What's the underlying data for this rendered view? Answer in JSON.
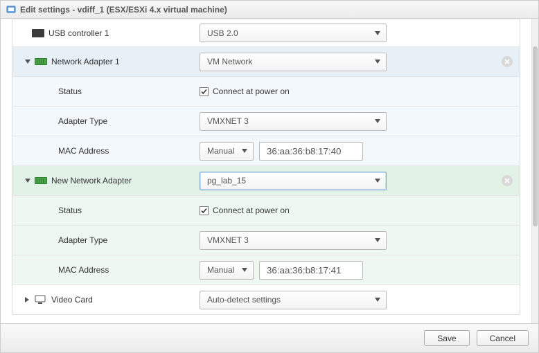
{
  "title": "Edit settings - vdiff_1 (ESX/ESXi 4.x virtual machine)",
  "usb": {
    "label": "USB controller 1",
    "value": "USB 2.0"
  },
  "nic1": {
    "label": "Network Adapter 1",
    "network": "VM Network",
    "status_label": "Status",
    "connect": "Connect at power on",
    "adapter_type_label": "Adapter Type",
    "adapter_type": "VMXNET 3",
    "mac_label": "MAC Address",
    "mac_mode": "Manual",
    "mac": "36:aa:36:b8:17:40"
  },
  "nic2": {
    "label": "New Network Adapter",
    "network": "pg_lab_15",
    "status_label": "Status",
    "connect": "Connect at power on",
    "adapter_type_label": "Adapter Type",
    "adapter_type": "VMXNET 3",
    "mac_label": "MAC Address",
    "mac_mode": "Manual",
    "mac": "36:aa:36:b8:17:41"
  },
  "video": {
    "label": "Video Card",
    "value": "Auto-detect settings"
  },
  "footer": {
    "save": "Save",
    "cancel": "Cancel"
  }
}
